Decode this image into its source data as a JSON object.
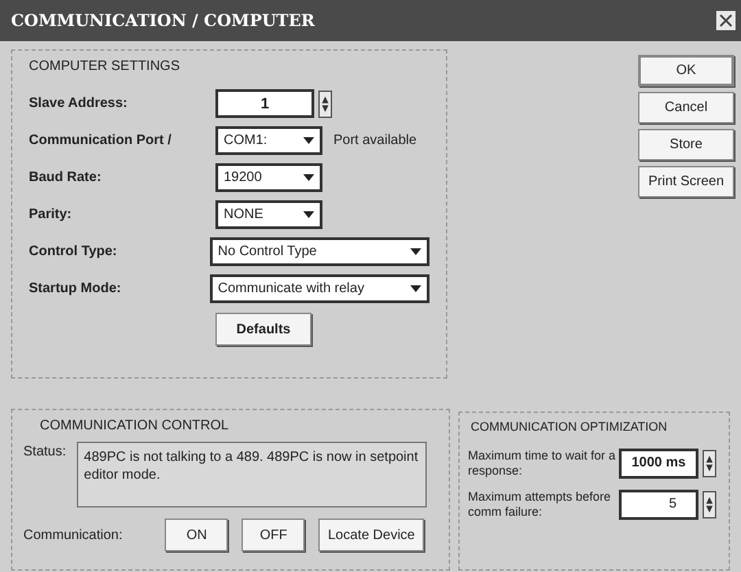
{
  "window": {
    "title": "COMMUNICATION / COMPUTER"
  },
  "computer_settings": {
    "title": "COMPUTER SETTINGS",
    "fields": [
      {
        "kind": "spin",
        "label": "Slave Address:",
        "value": "1"
      },
      {
        "kind": "combo",
        "label": "Communication Port /",
        "value": "COM1:",
        "note": "Port available"
      },
      {
        "kind": "combo",
        "label": "Baud Rate:",
        "value": "19200"
      },
      {
        "kind": "combo",
        "label": "Parity:",
        "value": "NONE"
      },
      {
        "kind": "wide_combo",
        "label": "Control Type:",
        "value": "No Control Type"
      },
      {
        "kind": "wide_combo",
        "label": "Startup Mode:",
        "value": "Communicate with relay"
      }
    ],
    "defaults_button": "Defaults"
  },
  "buttons": [
    "OK",
    "Cancel",
    "Store",
    "Print Screen"
  ],
  "communication_control": {
    "title": "COMMUNICATION CONTROL",
    "status_label": "Status:",
    "status_text": "489PC is not talking to a 489.  489PC is now in setpoint editor mode.",
    "communication_label": "Communication:",
    "buttons": [
      "ON",
      "OFF",
      "Locate Device"
    ]
  },
  "communication_optimization": {
    "title": "COMMUNICATION OPTIMIZATION",
    "fields": [
      {
        "label": "Maximum time to wait for a response:",
        "value": "1000 ms"
      },
      {
        "label": "Maximum attempts before comm failure:",
        "value": "5"
      }
    ]
  }
}
